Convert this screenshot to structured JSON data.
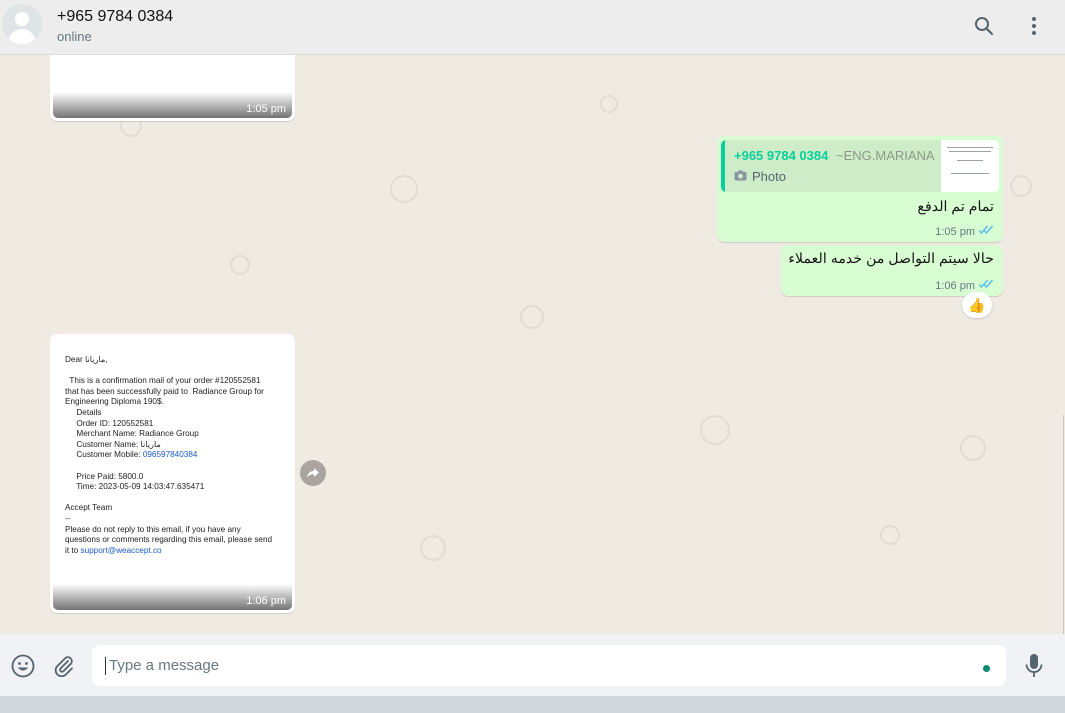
{
  "header": {
    "contact_name": "+965 9784 0384",
    "status": "online",
    "icons": [
      "search-icon",
      "menu-dots-icon"
    ]
  },
  "messages": {
    "first_image": {
      "time": "1:05 pm"
    },
    "quoted_reply": {
      "quote_author": "+965 9784 0384",
      "quote_push_name": "~ENG.MARIANA",
      "quote_type": "Photo",
      "text": "تمام تم الدفع",
      "time": "1:05 pm",
      "status": "read"
    },
    "second_out": {
      "text": "حالا سيتم التواصل من خدمه العملاء",
      "time": "1:06 pm",
      "status": "read",
      "reaction": "👍"
    },
    "email_image": {
      "time": "1:06 pm",
      "lines": [
        "Dear ماريانا,",
        "",
        "  This is a confirmation mail of your order #120552581",
        "that has been successfully paid to  Radiance Group for",
        "Engineering Diploma 190$.",
        "     Details",
        "     Order ID: 120552581",
        "     Merchant Name: Radiance Group",
        "     Customer Name: ماريانا",
        "     Customer Mobile: "
      ],
      "mobile": "096597840384",
      "lines2": [
        "",
        "     Price Paid: 5800.0",
        "     Time: 2023-05-09 14:03:47.635471",
        "",
        "Accept Team",
        "--",
        "Please do not reply to this email, if you have any",
        "questions or comments regarding this email, please send",
        "it to "
      ],
      "support_email": "support@weaccept.co"
    }
  },
  "footer": {
    "placeholder": "Type a message",
    "icons": [
      "emoji-icon",
      "attach-icon",
      "mic-icon"
    ]
  },
  "colors": {
    "accent": "#06cf9c",
    "outgoing_bubble": "#d9fdd3",
    "read_ticks": "#53bdeb",
    "chat_bg": "#efeae2"
  }
}
